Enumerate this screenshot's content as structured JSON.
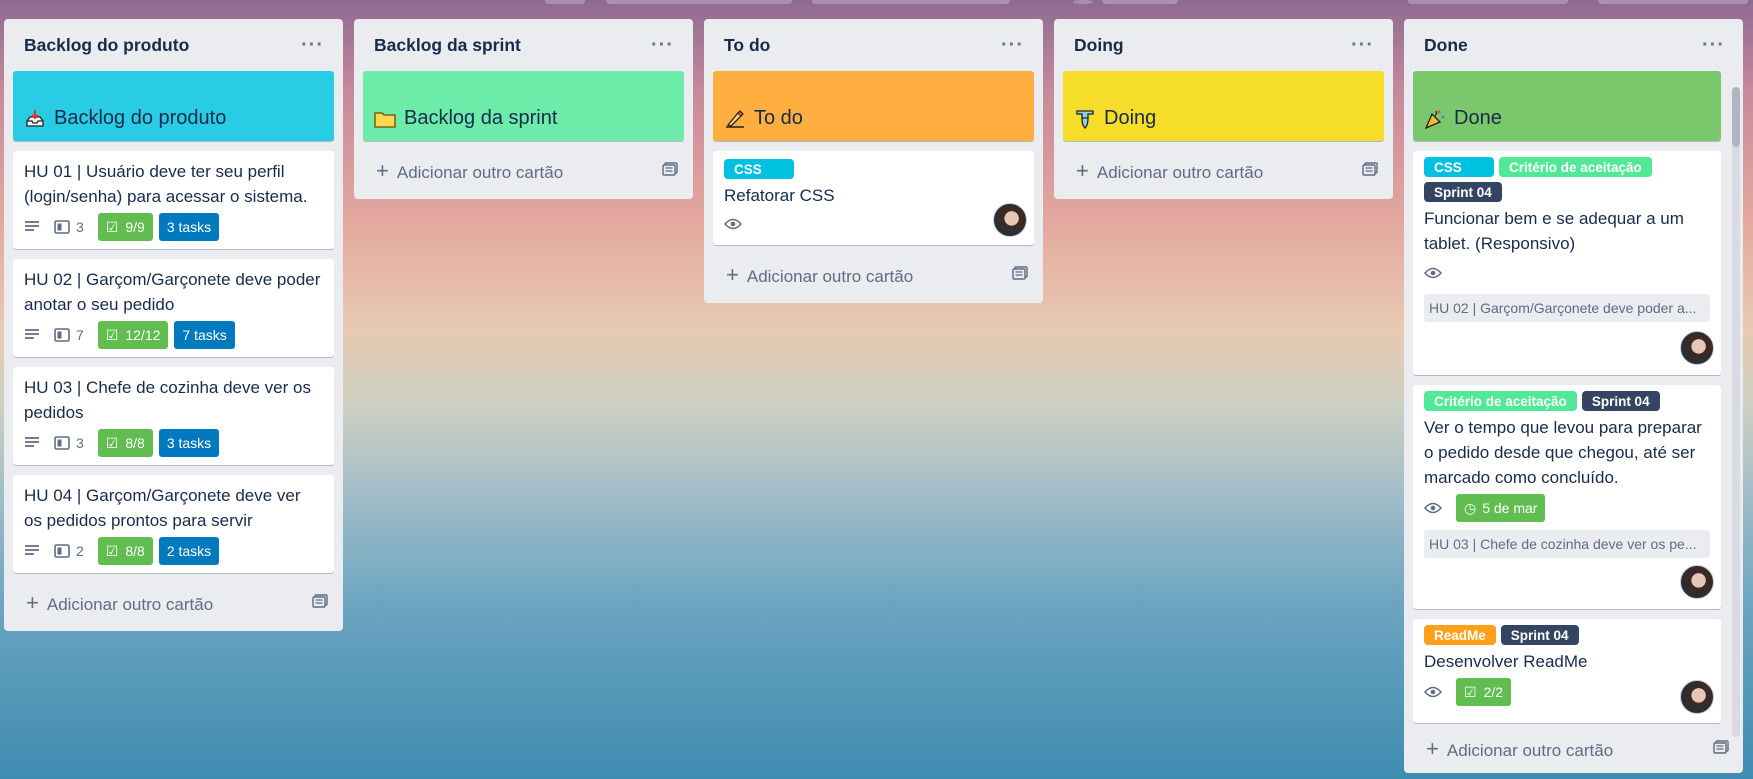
{
  "lists": [
    {
      "title": "Backlog do produto",
      "cover": {
        "emoji": "inbox-tray-icon",
        "title": "Backlog do produto",
        "color": "#29cce5"
      },
      "cards": [
        {
          "title": "HU 01 | Usuário deve ter seu perfil (login/senha) para acessar o sistema.",
          "attachments": "3",
          "checklist": "9/9",
          "tasks": "3 tasks"
        },
        {
          "title": "HU 02 | Garçom/Garçonete deve poder anotar o seu pedido",
          "attachments": "7",
          "checklist": "12/12",
          "tasks": "7 tasks"
        },
        {
          "title": "HU 03 | Chefe de cozinha deve ver os pedidos",
          "attachments": "3",
          "checklist": "8/8",
          "tasks": "3 tasks"
        },
        {
          "title": "HU 04 | Garçom/Garçonete deve ver os pedidos prontos para servir",
          "attachments": "2",
          "checklist": "8/8",
          "tasks": "2 tasks"
        }
      ],
      "add_label": "Adicionar outro cartão"
    },
    {
      "title": "Backlog da sprint",
      "cover": {
        "emoji": "folder-icon",
        "title": "Backlog da sprint",
        "color": "#6deca9"
      },
      "add_label": "Adicionar outro cartão"
    },
    {
      "title": "To do",
      "cover": {
        "emoji": "writing-hand-icon",
        "title": "To do",
        "color": "#ffaf3f"
      },
      "card": {
        "label": "CSS",
        "label_color": "#00c2e0",
        "title": "Refatorar CSS"
      },
      "add_label": "Adicionar outro cartão"
    },
    {
      "title": "Doing",
      "cover": {
        "emoji": "flexed-biceps-icon",
        "title": "Doing",
        "color": "#f5dd29"
      },
      "add_label": "Adicionar outro cartão"
    },
    {
      "title": "Done",
      "cover": {
        "emoji": "party-popper-icon",
        "title": "Done",
        "color": "#7bc86c"
      },
      "cards": [
        {
          "labels": [
            {
              "text": "CSS",
              "color": "#00c2e0"
            },
            {
              "text": "Critério de aceitação",
              "color": "#51e898"
            },
            {
              "text": "Sprint 04",
              "color": "#344563"
            }
          ],
          "title": "Funcionar bem e se adequar a um tablet. (Responsivo)",
          "attachment": "HU 02 | Garçom/Garçonete deve poder a..."
        },
        {
          "labels": [
            {
              "text": "Critério de aceitação",
              "color": "#51e898"
            },
            {
              "text": "Sprint 04",
              "color": "#344563"
            }
          ],
          "title": "Ver o tempo que levou para preparar o pedido desde que chegou, até ser marcado como concluído.",
          "due": "5 de mar",
          "attachment": "HU 03 | Chefe de cozinha deve ver os pe..."
        },
        {
          "labels": [
            {
              "text": "ReadMe",
              "color": "#ff9f1a"
            },
            {
              "text": "Sprint 04",
              "color": "#344563"
            }
          ],
          "title": "Desenvolver ReadMe",
          "checklist": "2/2"
        }
      ],
      "add_label": "Adicionar outro cartão"
    }
  ]
}
